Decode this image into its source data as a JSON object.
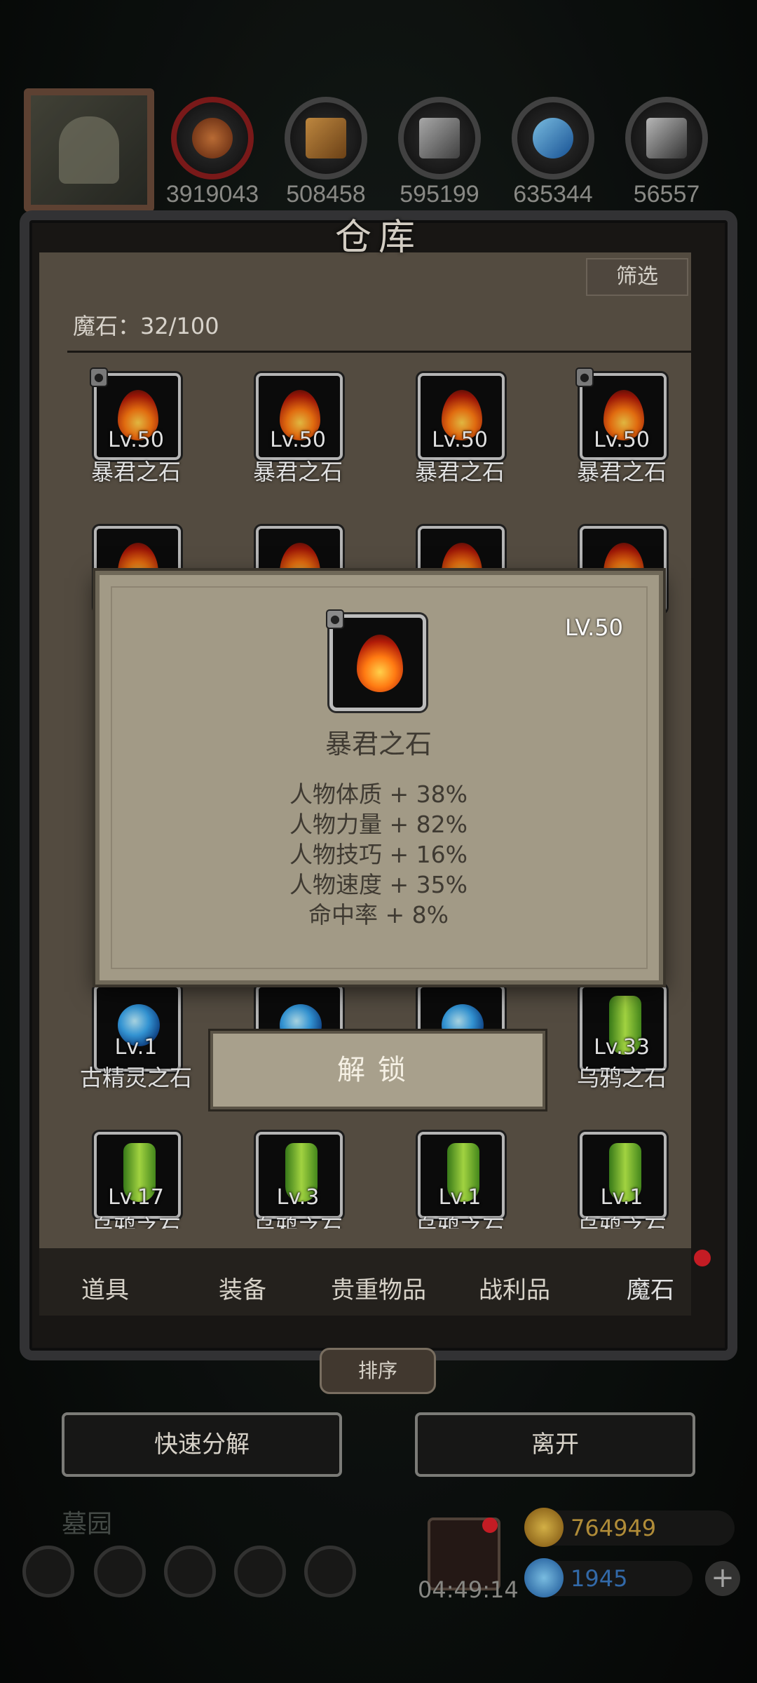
{
  "resources": [
    {
      "icon": "meat-icon",
      "value": "3919043"
    },
    {
      "icon": "wood-icon",
      "value": "508458"
    },
    {
      "icon": "iron-icon",
      "value": "595199"
    },
    {
      "icon": "crystal-icon",
      "value": "635344"
    },
    {
      "icon": "steel-icon",
      "value": "56557"
    }
  ],
  "panel": {
    "title": "仓库",
    "filter_label": "筛选",
    "count_text": "魔石：32/100"
  },
  "items": [
    {
      "lv": "Lv.50",
      "name": "暴君之石",
      "kind": "fire",
      "locked": true
    },
    {
      "lv": "Lv.50",
      "name": "暴君之石",
      "kind": "fire",
      "locked": false
    },
    {
      "lv": "Lv.50",
      "name": "暴君之石",
      "kind": "fire",
      "locked": false
    },
    {
      "lv": "Lv.50",
      "name": "暴君之石",
      "kind": "fire",
      "locked": true
    },
    {
      "lv": "Lv.1",
      "name": "古精灵之石",
      "kind": "gem"
    },
    {
      "lv": "Lv.33",
      "name": "乌鸦之石",
      "kind": "crystal"
    },
    {
      "lv": "Lv.17",
      "name": "乌鸦之石",
      "kind": "crystal"
    },
    {
      "lv": "Lv.3",
      "name": "乌鸦之石",
      "kind": "crystal"
    },
    {
      "lv": "Lv.1",
      "name": "乌鸦之石",
      "kind": "crystal"
    },
    {
      "lv": "Lv.1",
      "name": "乌鸦之石",
      "kind": "crystal"
    }
  ],
  "tabs": [
    "道具",
    "装备",
    "贵重物品",
    "战利品",
    "魔石"
  ],
  "sort_label": "排序",
  "buttons": {
    "quick_decompose": "快速分解",
    "leave": "离开"
  },
  "footer": {
    "location": "墓园",
    "timer": "04:49:14",
    "gold": "764949",
    "gems": "1945",
    "plus": "+"
  },
  "popup": {
    "level": "LV.50",
    "name": "暴君之石",
    "stats": [
      "人物体质 + 38%",
      "人物力量 + 82%",
      "人物技巧 + 16%",
      "人物速度 + 35%",
      "命中率 + 8%"
    ],
    "unlock_label": "解锁"
  },
  "colors": {
    "alert": "#e0202a",
    "gold": "#c9a040",
    "gem": "#3a78c0"
  }
}
